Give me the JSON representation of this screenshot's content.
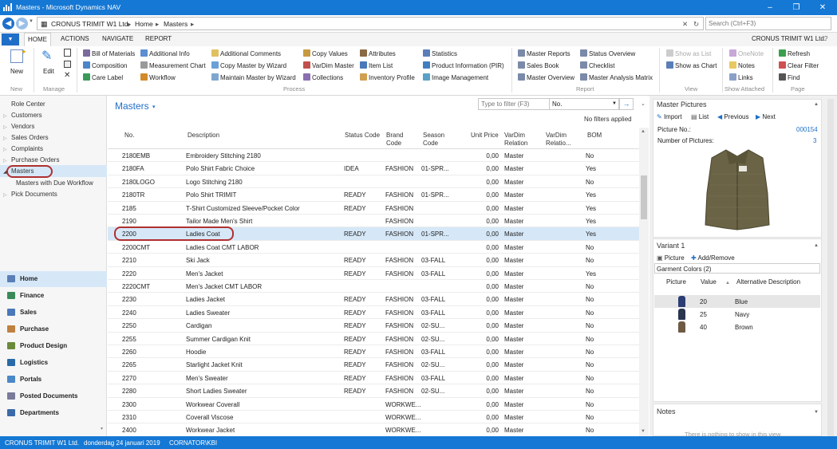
{
  "window": {
    "title": "Masters - Microsoft Dynamics NAV"
  },
  "address": {
    "company": "CRONUS TRIMIT W1 Ltd.",
    "crumb1": "Home",
    "crumb2": "Masters",
    "search_placeholder": "Search (Ctrl+F3)"
  },
  "ribbon_tabs": {
    "home": "HOME",
    "actions": "ACTIONS",
    "navigate": "NAVIGATE",
    "report": "REPORT"
  },
  "company_right": "CRONUS TRIMIT W1 Ltd.",
  "ribbon": {
    "new": "New",
    "edit": "Edit",
    "bill_of_materials": "Bill of Materials",
    "composition": "Composition",
    "care_label": "Care Label",
    "additional_info": "Additional Info",
    "measurement_chart": "Measurement Chart",
    "workflow": "Workflow",
    "additional_comments": "Additional Comments",
    "copy_master_by_wizard": "Copy Master by Wizard",
    "maintain_master_by_wizard": "Maintain Master by Wizard",
    "copy_values": "Copy Values",
    "vardim_master": "VarDim Master",
    "collections": "Collections",
    "attributes": "Attributes",
    "item_list": "Item List",
    "inventory_profile": "Inventory Profile",
    "statistics": "Statistics",
    "product_information": "Product Information (PIR)",
    "image_management": "Image Management",
    "master_reports": "Master Reports",
    "sales_book": "Sales Book",
    "master_overview": "Master Overview",
    "status_overview": "Status Overview",
    "checklist": "Checklist",
    "master_analysis_matrix": "Master Analysis Matrix",
    "show_as_list": "Show as List",
    "show_as_chart": "Show as Chart",
    "onenote": "OneNote",
    "notes": "Notes",
    "links": "Links",
    "refresh": "Refresh",
    "clear_filter": "Clear Filter",
    "find": "Find",
    "groups": {
      "new": "New",
      "manage": "Manage",
      "process": "Process",
      "report": "Report",
      "view": "View",
      "show_attached": "Show Attached",
      "page": "Page"
    }
  },
  "nav": {
    "items": [
      "Role Center",
      "Customers",
      "Vendors",
      "Sales Orders",
      "Complaints",
      "Purchase Orders",
      "Masters",
      "Masters with Due Workflow",
      "Pick Documents"
    ],
    "sections": [
      "Home",
      "Finance",
      "Sales",
      "Purchase",
      "Product Design",
      "Logistics",
      "Portals",
      "Posted Documents",
      "Departments"
    ]
  },
  "list": {
    "title": "Masters",
    "filter_placeholder": "Type to filter (F3)",
    "filter_field": "No.",
    "no_filters": "No filters applied",
    "headers": {
      "no": "No.",
      "description": "Description",
      "status_code": "Status Code",
      "brand_code": "Brand Code",
      "season_code": "Season Code",
      "unit_price": "Unit Price",
      "vardim_relation": "VarDim Relation",
      "vardim_relation2": "VarDim Relatio...",
      "bom": "BOM"
    },
    "rows": [
      [
        "2180EMB",
        "Embroidery Stitching 2180",
        "",
        "",
        "",
        "0,00",
        "Master",
        "No"
      ],
      [
        "2180FA",
        "Polo Shirt Fabric Choice",
        "IDEA",
        "FASHION",
        "01-SPR...",
        "0,00",
        "Master",
        "Yes"
      ],
      [
        "2180LOGO",
        "Logo Stitching 2180",
        "",
        "",
        "",
        "0,00",
        "Master",
        "No"
      ],
      [
        "2180TR",
        "Polo Shirt TRIMIT",
        "READY",
        "FASHION",
        "01-SPR...",
        "0,00",
        "Master",
        "Yes"
      ],
      [
        "2185",
        "T-Shirt Customized Sleeve/Pocket Color",
        "READY",
        "FASHION",
        "",
        "0,00",
        "Master",
        "Yes"
      ],
      [
        "2190",
        "Tailor Made Men's Shirt",
        "",
        "FASHION",
        "",
        "0,00",
        "Master",
        "Yes"
      ],
      [
        "2200",
        "Ladies Coat",
        "READY",
        "FASHION",
        "01-SPR...",
        "0,00",
        "Master",
        "Yes"
      ],
      [
        "2200CMT",
        "Ladies Coat CMT LABOR",
        "",
        "",
        "",
        "0,00",
        "Master",
        "No"
      ],
      [
        "2210",
        "Ski Jack",
        "READY",
        "FASHION",
        "03-FALL",
        "0,00",
        "Master",
        "No"
      ],
      [
        "2220",
        "Men's Jacket",
        "READY",
        "FASHION",
        "03-FALL",
        "0,00",
        "Master",
        "Yes"
      ],
      [
        "2220CMT",
        "Men's Jacket CMT LABOR",
        "",
        "",
        "",
        "0,00",
        "Master",
        "No"
      ],
      [
        "2230",
        "Ladies Jacket",
        "READY",
        "FASHION",
        "03-FALL",
        "0,00",
        "Master",
        "No"
      ],
      [
        "2240",
        "Ladies Sweater",
        "READY",
        "FASHION",
        "03-FALL",
        "0,00",
        "Master",
        "No"
      ],
      [
        "2250",
        "Cardigan",
        "READY",
        "FASHION",
        "02-SU...",
        "0,00",
        "Master",
        "No"
      ],
      [
        "2255",
        "Summer Cardigan Knit",
        "READY",
        "FASHION",
        "02-SU...",
        "0,00",
        "Master",
        "No"
      ],
      [
        "2260",
        "Hoodie",
        "READY",
        "FASHION",
        "03-FALL",
        "0,00",
        "Master",
        "No"
      ],
      [
        "2265",
        "Starlight Jacket Knit",
        "READY",
        "FASHION",
        "02-SU...",
        "0,00",
        "Master",
        "No"
      ],
      [
        "2270",
        "Men's Sweater",
        "READY",
        "FASHION",
        "03-FALL",
        "0,00",
        "Master",
        "No"
      ],
      [
        "2280",
        "Short Ladies Sweater",
        "READY",
        "FASHION",
        "02-SU...",
        "0,00",
        "Master",
        "No"
      ],
      [
        "2300",
        "Workwear Coverall",
        "",
        "WORKWE...",
        "",
        "0,00",
        "Master",
        "No"
      ],
      [
        "2310",
        "Coverall Viscose",
        "",
        "WORKWE...",
        "",
        "0,00",
        "Master",
        "No"
      ],
      [
        "2400",
        "Workwear Jacket",
        "",
        "WORKWE...",
        "",
        "0,00",
        "Master",
        "No"
      ]
    ]
  },
  "master_pictures": {
    "title": "Master Pictures",
    "import": "Import",
    "list": "List",
    "previous": "Previous",
    "next": "Next",
    "picture_no_label": "Picture No.:",
    "picture_no": "000154",
    "num_pictures_label": "Number of Pictures:",
    "num_pictures": "3"
  },
  "variant": {
    "title": "Variant 1",
    "picture": "Picture",
    "add_remove": "Add/Remove",
    "group": "Garment Colors (2)",
    "headers": {
      "picture": "Picture",
      "value": "Value",
      "alt": "Alternative Description"
    },
    "rows": [
      [
        "20",
        "Blue"
      ],
      [
        "25",
        "Navy"
      ],
      [
        "40",
        "Brown"
      ]
    ]
  },
  "notes": {
    "title": "Notes",
    "empty": "There is nothing to show in this view"
  },
  "status": {
    "company": "CRONUS TRIMIT W1 Ltd.",
    "date": "donderdag 24 januari 2019",
    "user": "CORNATOR\\KBI"
  },
  "colors": {
    "accent": "#1578d4",
    "link": "#1f6fc9",
    "selected": "#d6e8f8",
    "callout": "#b03030",
    "variant_blue": "#2c3e73",
    "variant_navy": "#2a3550",
    "variant_brown": "#6e5a43"
  }
}
